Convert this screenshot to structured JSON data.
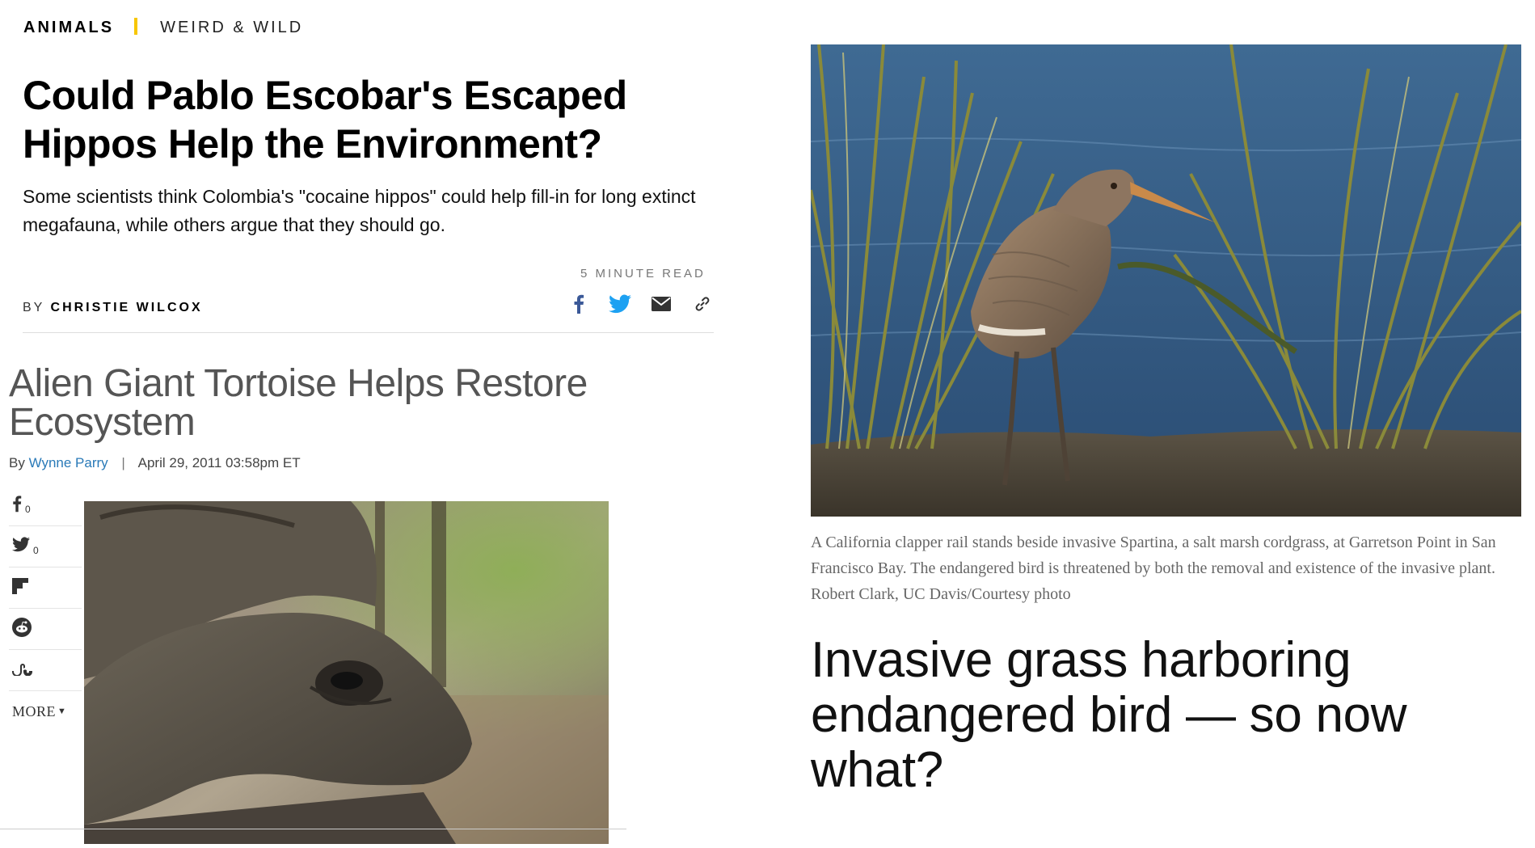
{
  "article1": {
    "section": "ANIMALS",
    "subsection": "WEIRD & WILD",
    "title": "Could Pablo Escobar's Escaped Hippos Help the Environment?",
    "dek": "Some scientists think Colombia's \"cocaine hippos\" could help fill-in for long extinct megafauna, while others argue that they should go.",
    "read_time": "5 MINUTE READ",
    "byline_prefix": "BY",
    "author": "CHRISTIE WILCOX",
    "share_icons": [
      "facebook-icon",
      "twitter-icon",
      "email-icon",
      "link-icon"
    ],
    "colors": {
      "accent": "#f7c600",
      "facebook": "#3b5998",
      "twitter": "#1da1f2"
    }
  },
  "article2": {
    "title": "Alien Giant Tortoise Helps Restore Ecosystem",
    "by": "By",
    "author": "Wynne Parry",
    "separator": "|",
    "date": "April 29, 2011 03:58pm ET",
    "rail": [
      {
        "icon": "facebook-icon",
        "count": "0"
      },
      {
        "icon": "twitter-icon",
        "count": "0"
      },
      {
        "icon": "flipboard-icon",
        "count": ""
      },
      {
        "icon": "reddit-icon",
        "count": ""
      },
      {
        "icon": "stumbleupon-icon",
        "count": ""
      }
    ],
    "more_label": "MORE",
    "colors": {
      "author_link": "#2a7ab8"
    }
  },
  "article3": {
    "caption": "A California clapper rail stands beside invasive Spartina, a salt marsh cordgrass, at Garretson Point in San Francisco Bay. The endangered bird is threatened by both the removal and existence of the invasive plant. Robert Clark, UC Davis/Courtesy photo",
    "title": "Invasive grass harboring endangered bird — so now what?"
  }
}
